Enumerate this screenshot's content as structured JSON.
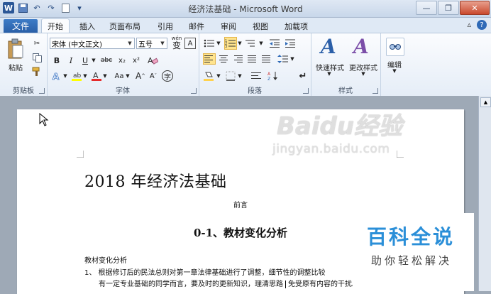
{
  "window": {
    "title": "经济法基础 - Microsoft Word"
  },
  "tabs": {
    "file": "文件",
    "items": [
      "开始",
      "插入",
      "页面布局",
      "引用",
      "邮件",
      "审阅",
      "视图",
      "加载项"
    ]
  },
  "ribbon": {
    "clipboard": {
      "paste": "粘贴",
      "label": "剪贴板"
    },
    "font": {
      "name": "宋体 (中文正文)",
      "size": "五号",
      "label": "字体",
      "wen": "wén",
      "bold": "B",
      "italic": "I",
      "underline": "U",
      "strike": "abc",
      "sub": "x₂",
      "sup": "x²",
      "aa": "Aa",
      "grow": "A",
      "shrink": "A",
      "char_a": "A"
    },
    "paragraph": {
      "label": "段落"
    },
    "styles": {
      "quick": "快速样式",
      "change": "更改样式",
      "label": "样式"
    },
    "editing": {
      "label": "编辑"
    }
  },
  "document": {
    "title": "2018 年经济法基础",
    "preface": "前言",
    "section": "0-1、教材变化分析",
    "line1": "教材变化分析",
    "line2_a": "1、 根据修订后的民法总则对第一章法律基础进行了调整，细节性的调整比较",
    "line3_a": "有一定专业基础的同学而言，要及时的更新知识，理清思路",
    "line3_b": "免受原有内容的干扰。"
  },
  "watermark": {
    "logo": "Baidu经验",
    "url": "jingyan.baidu.com"
  },
  "badge": {
    "title": "百科全说",
    "subtitle": "助你轻松解决"
  }
}
